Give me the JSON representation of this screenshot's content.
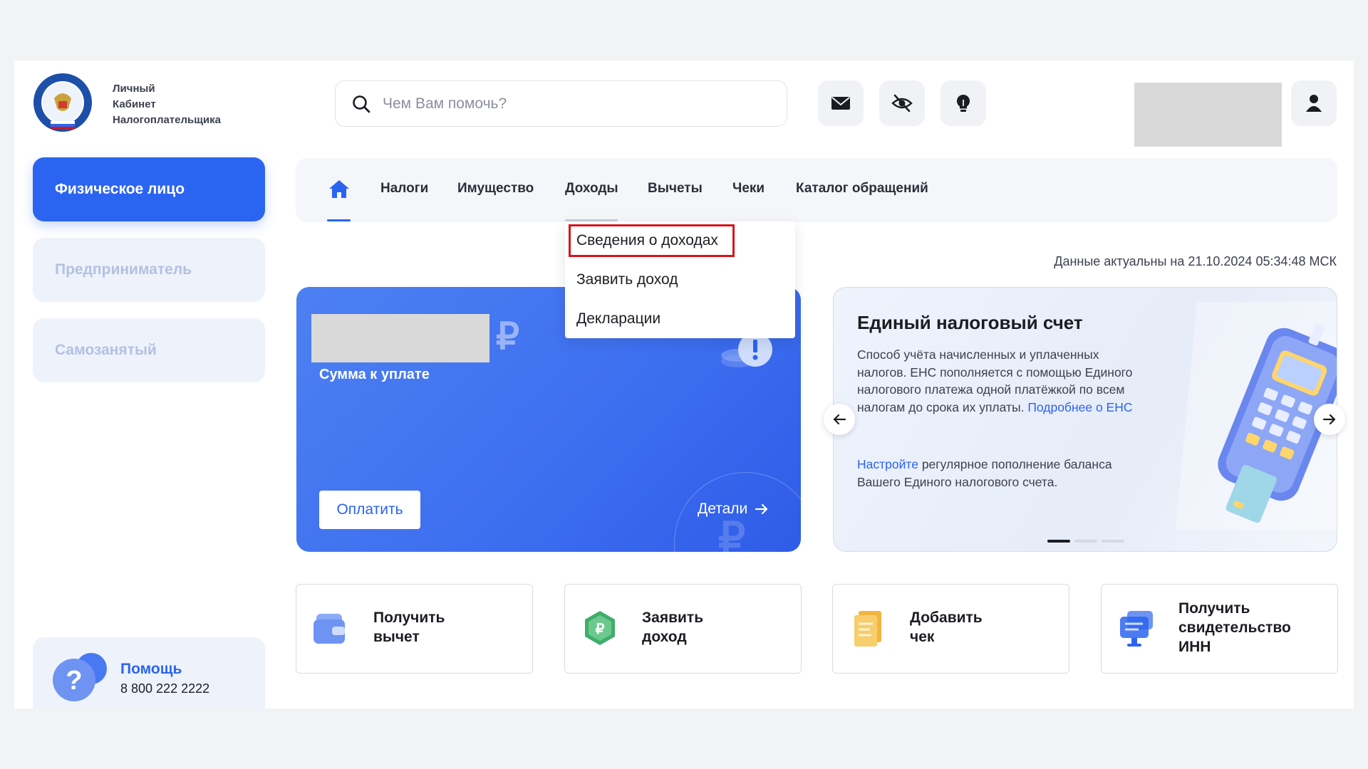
{
  "header": {
    "brand_lines": [
      "Личный",
      "Кабинет",
      "Налогоплательщика"
    ],
    "search_placeholder": "Чем Вам помочь?"
  },
  "sidebar": {
    "items": [
      {
        "label": "Физическое лицо",
        "active": true
      },
      {
        "label": "Предприниматель",
        "active": false
      },
      {
        "label": "Самозанятый",
        "active": false
      }
    ],
    "help": {
      "title": "Помощь",
      "phone": "8 800 222 2222"
    }
  },
  "nav": {
    "items": [
      "Налоги",
      "Имущество",
      "Доходы",
      "Вычеты",
      "Чеки",
      "Каталог обращений"
    ],
    "active_hover": "Доходы"
  },
  "dropdown": {
    "items": [
      "Сведения о доходах",
      "Заявить доход",
      "Декларации"
    ],
    "highlighted": "Сведения о доходах"
  },
  "status": {
    "actual_text": "Данные актуальны на 21.10.2024 05:34:48 МСК"
  },
  "pay_card": {
    "currency": "₽",
    "sum_label": "Сумма к уплате",
    "pay_button": "Оплатить",
    "details_link": "Детали"
  },
  "ens_card": {
    "title": "Единый налоговый счет",
    "text": "Способ учёта начисленных и уплаченных налогов. ЕНС пополняется с помощью Единого налогового платежа одной платёжкой по всем налогам до срока их уплаты.",
    "more_link": "Подробнее о ЕНС",
    "text2_link": "Настройте",
    "text2": "регулярное пополнение баланса Вашего Единого налогового счета.",
    "slides_total": 3,
    "active_slide": 1
  },
  "tiles": [
    {
      "lines": [
        "Получить",
        "вычет"
      ],
      "icon": "wallet-icon"
    },
    {
      "lines": [
        "Заявить",
        "доход"
      ],
      "icon": "ruble-coin-icon"
    },
    {
      "lines": [
        "Добавить",
        "чек"
      ],
      "icon": "receipt-icon"
    },
    {
      "lines": [
        "Получить",
        "свидетельство",
        "ИНН"
      ],
      "icon": "certificate-monitor-icon"
    }
  ],
  "colors": {
    "accent": "#2b64f0",
    "highlight_border": "#d8141d",
    "sidebar_inactive_bg": "#eef2fb"
  }
}
